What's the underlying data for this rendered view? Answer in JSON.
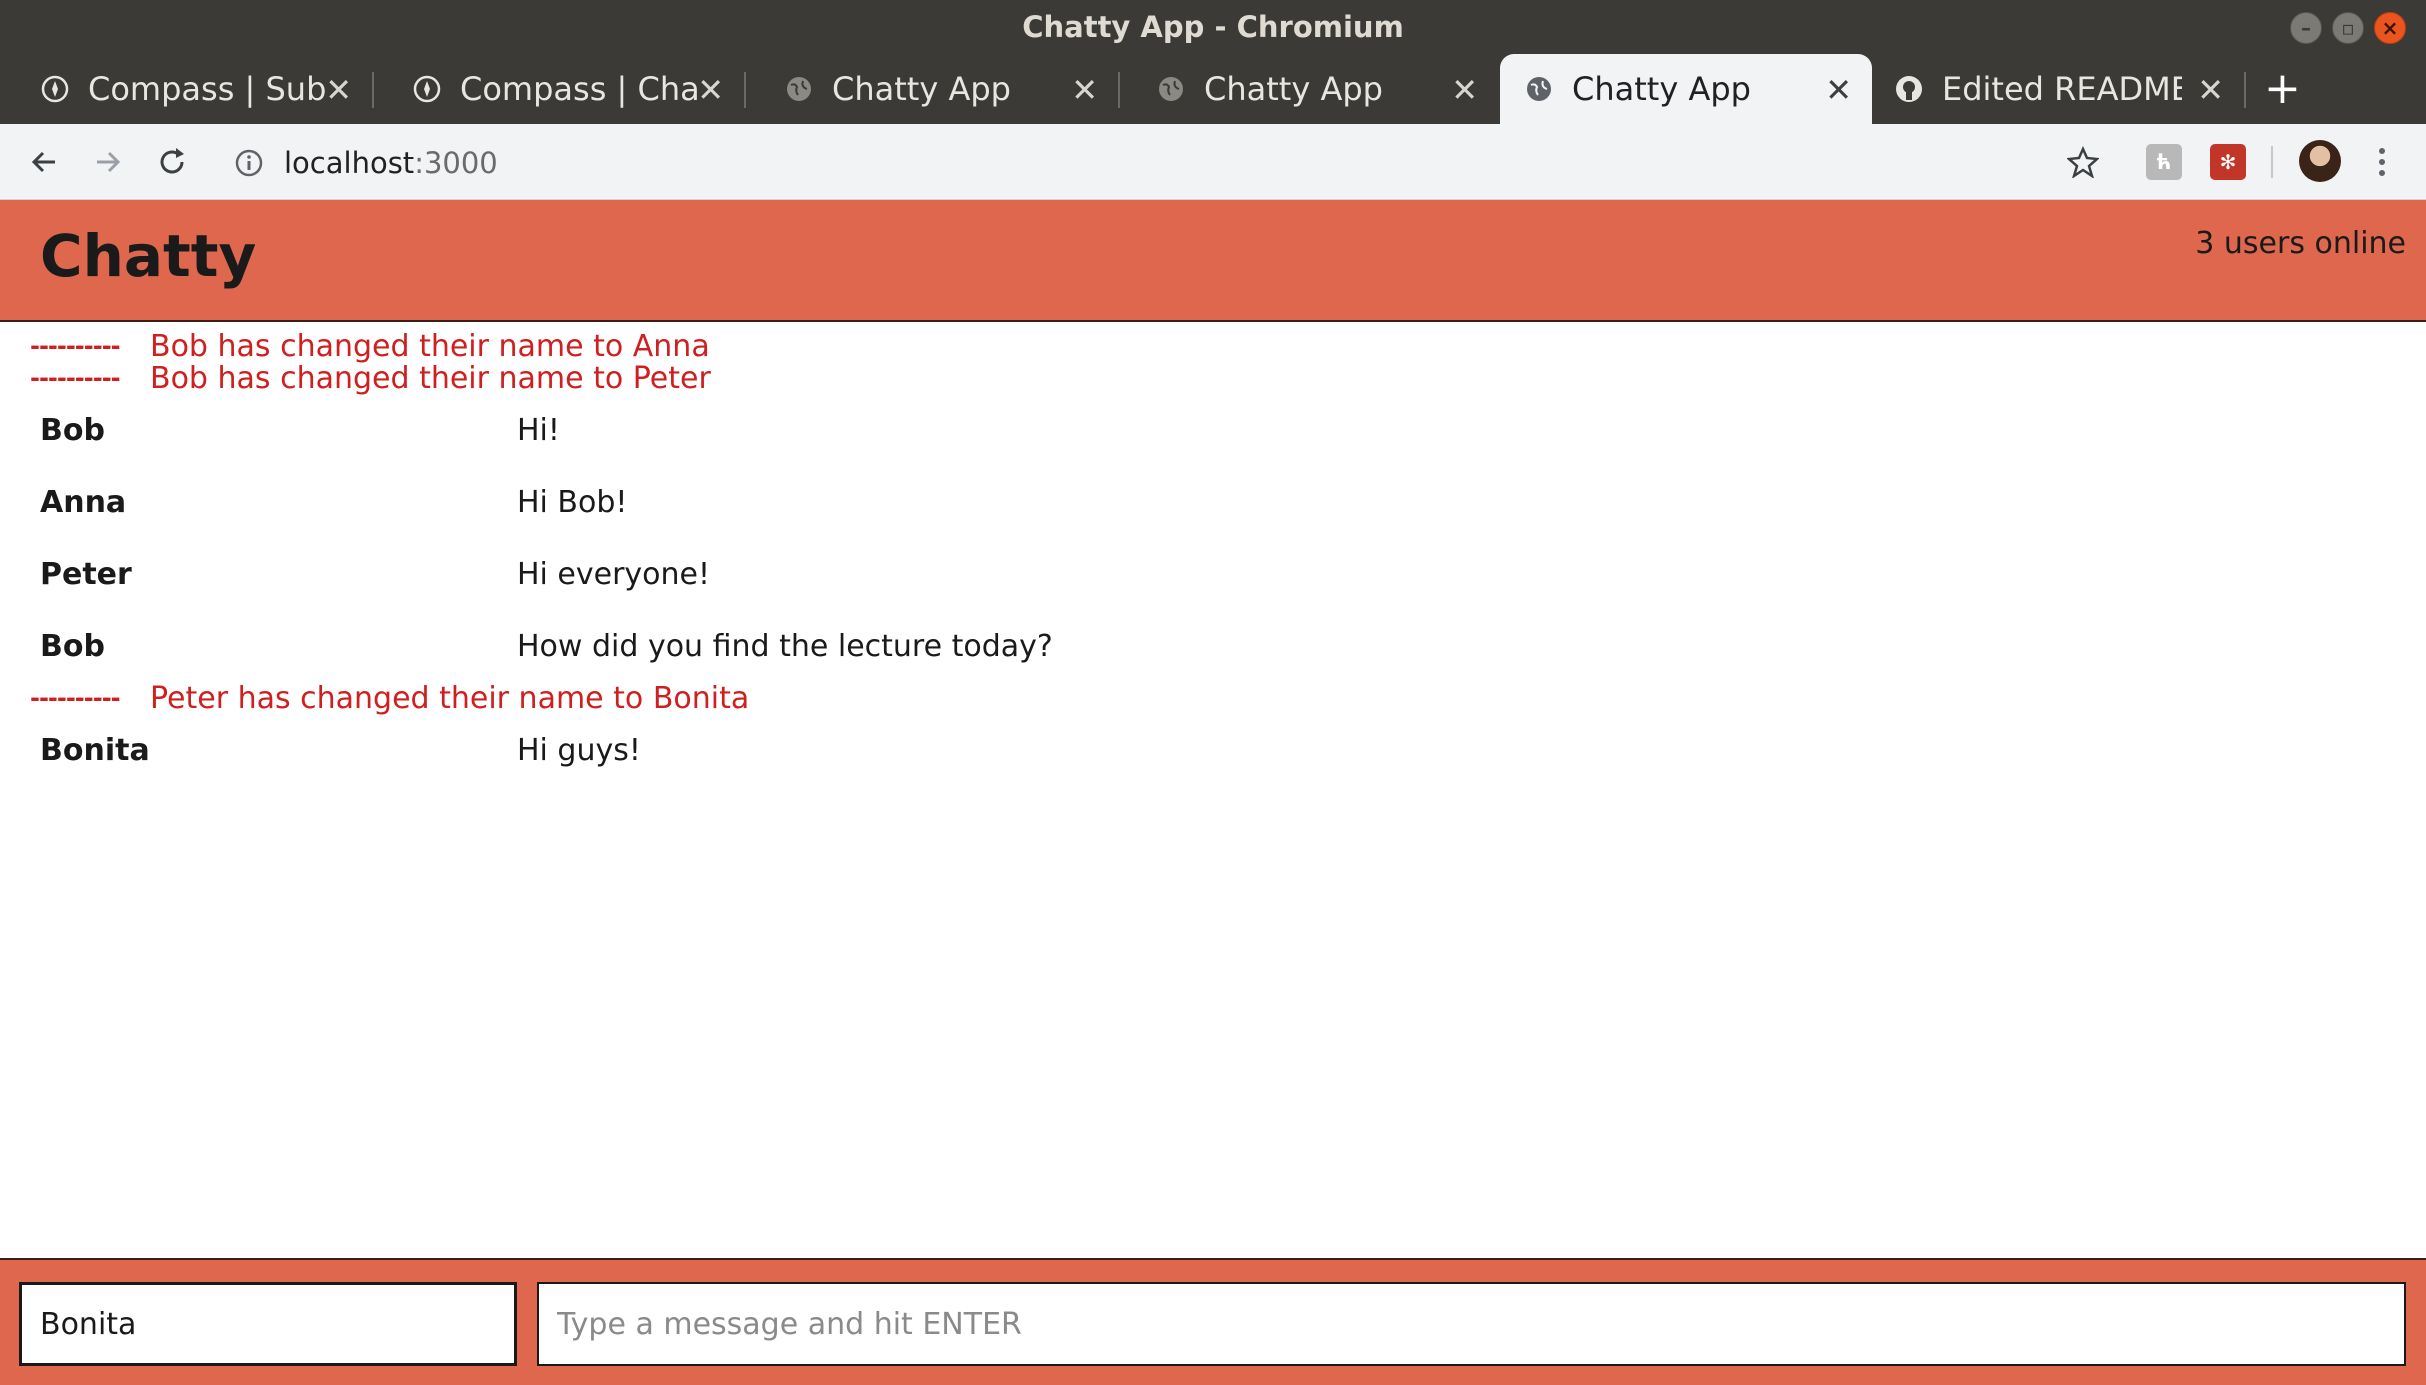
{
  "window": {
    "title": "Chatty App - Chromium"
  },
  "tabs": [
    {
      "title": "Compass | Submit",
      "icon": "compass-icon",
      "active": false
    },
    {
      "title": "Compass | Chatty",
      "icon": "compass-icon",
      "active": false
    },
    {
      "title": "Chatty App",
      "icon": "globe-icon",
      "active": false
    },
    {
      "title": "Chatty App",
      "icon": "globe-icon",
      "active": false
    },
    {
      "title": "Chatty App",
      "icon": "globe-icon",
      "active": true
    },
    {
      "title": "Edited README.m",
      "icon": "github-icon",
      "active": false
    }
  ],
  "address_bar": {
    "host": "localhost",
    "port": ":3000"
  },
  "app": {
    "title": "Chatty",
    "user_count": "3 users online",
    "accent_color": "#df674e",
    "notification_color": "#d01f1f",
    "feed": [
      {
        "type": "notification",
        "dashes": "----------",
        "text": "Bob has changed their name to Anna"
      },
      {
        "type": "notification",
        "dashes": "----------",
        "text": "Bob has changed their name to Peter"
      },
      {
        "type": "message",
        "username": "Bob",
        "content": "Hi!"
      },
      {
        "type": "message",
        "username": "Anna",
        "content": "Hi Bob!"
      },
      {
        "type": "message",
        "username": "Peter",
        "content": "Hi everyone!"
      },
      {
        "type": "message",
        "username": "Bob",
        "content": "How did you find the lecture today?"
      },
      {
        "type": "notification",
        "dashes": "----------",
        "text": "Peter has changed their name to Bonita"
      },
      {
        "type": "message",
        "username": "Bonita",
        "content": "Hi guys!"
      }
    ],
    "chatbar": {
      "username_value": "Bonita",
      "message_placeholder": "Type a message and hit ENTER"
    }
  }
}
